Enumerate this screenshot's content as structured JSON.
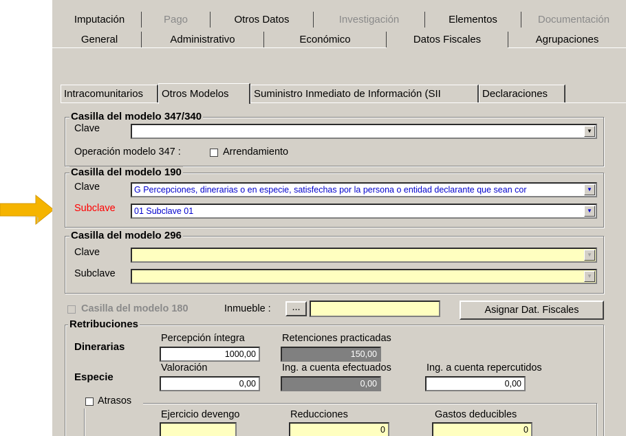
{
  "top_tabs_row1": [
    {
      "label": "Imputación",
      "disabled": false
    },
    {
      "label": "Pago",
      "disabled": true
    },
    {
      "label": "Otros Datos",
      "disabled": false
    },
    {
      "label": "Investigación",
      "disabled": true
    },
    {
      "label": "Elementos",
      "disabled": false
    },
    {
      "label": "Documentación",
      "disabled": true
    }
  ],
  "top_tabs_row2": [
    {
      "label": "General"
    },
    {
      "label": "Administrativo"
    },
    {
      "label": "Económico"
    },
    {
      "label": "Datos Fiscales",
      "active": true
    },
    {
      "label": "Agrupaciones"
    }
  ],
  "sub_tabs": [
    {
      "label": "Intracomunitarios"
    },
    {
      "label": "Otros Modelos",
      "active": true
    },
    {
      "label": "Suministro Inmediato de Información (SII"
    },
    {
      "label": "Declaraciones"
    }
  ],
  "m347": {
    "title": "Casilla del modelo 347/340",
    "clave_label": "Clave",
    "clave_value": "",
    "operacion_label": "Operación modelo 347 :",
    "arrendamiento_label": "Arrendamiento",
    "arrendamiento_checked": false
  },
  "m190": {
    "title": "Casilla del modelo 190",
    "clave_label": "Clave",
    "clave_value": "G Percepciones, dinerarias o en especie, satisfechas por la persona o entidad declarante que sean cor",
    "subclave_label": "Subclave",
    "subclave_value": "01 Subclave 01",
    "subclave_label_color": "#ff0000",
    "value_color": "#0000cc"
  },
  "m296": {
    "title": "Casilla del modelo 296",
    "clave_label": "Clave",
    "clave_value": "",
    "subclave_label": "Subclave",
    "subclave_value": ""
  },
  "m180": {
    "label": "Casilla del modelo 180",
    "checked": false,
    "inmueble_label": "Inmueble :",
    "inmueble_button": "...",
    "inmueble_value": "",
    "asignar_button": "Asignar Dat. Fiscales"
  },
  "retribuciones": {
    "title": "Retribuciones",
    "dinerarias_label": "Dinerarias",
    "especie_label": "Especie",
    "percepcion_label": "Percepción íntegra",
    "percepcion_value": "1000,00",
    "retenciones_label": "Retenciones practicadas",
    "retenciones_value": "150,00",
    "valoracion_label": "Valoración",
    "valoracion_value": "0,00",
    "ing_efectuados_label": "Ing. a cuenta efectuados",
    "ing_efectuados_value": "0,00",
    "ing_repercutidos_label": "Ing. a cuenta repercutidos",
    "ing_repercutidos_value": "0,00"
  },
  "atrasos": {
    "label": "Atrasos",
    "checked": false,
    "ejercicio_label": "Ejercicio devengo",
    "ejercicio_value": "",
    "reducciones_label": "Reducciones",
    "reducciones_value": "0",
    "gastos_label": "Gastos deducibles",
    "gastos_value": "0"
  },
  "colors": {
    "window_bg": "#d4d0c8",
    "field_yellow": "#ffffc0",
    "arrow": "#f5b400"
  },
  "icons": {
    "dropdown": "chevron-down-icon",
    "pointer": "arrow-right-icon"
  }
}
